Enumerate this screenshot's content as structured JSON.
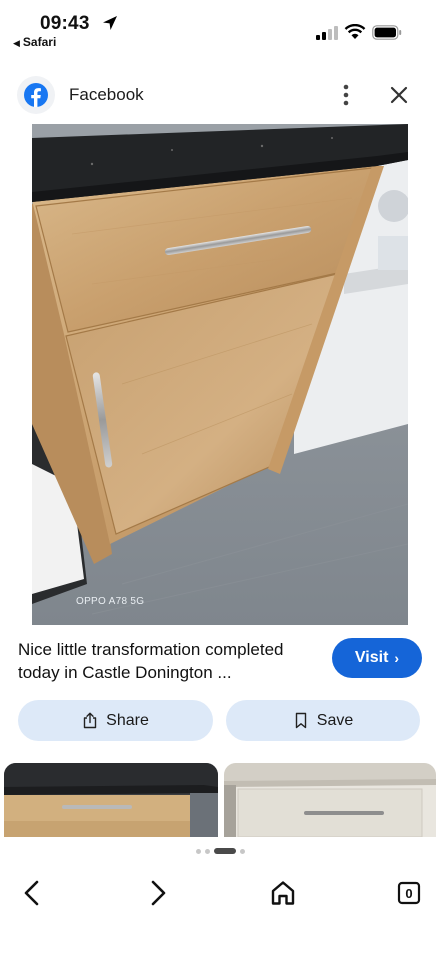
{
  "status_bar": {
    "time": "09:43",
    "back_app": "Safari",
    "icons": [
      "location-arrow-icon",
      "signal-icon",
      "wifi-icon",
      "battery-icon"
    ]
  },
  "header": {
    "title": "Facebook",
    "logo_icon": "facebook-logo-icon",
    "more_icon": "more-vertical-icon",
    "close_icon": "close-icon",
    "brand_color": "#1877f2"
  },
  "photo": {
    "subject": "oak-effect kitchen cabinet with black worktop and steel bar handles",
    "watermark": "OPPO A78 5G"
  },
  "post": {
    "caption": "Nice little transformation completed today in Castle Donington ...",
    "visit_label": "Visit",
    "visit_color": "#1565d8"
  },
  "actions": {
    "share_label": "Share",
    "save_label": "Save",
    "share_icon": "share-icon",
    "save_icon": "bookmark-icon",
    "button_color": "#dde9f8"
  },
  "thumbnails": [
    "cabinet-before-thumbnail",
    "cabinet-grey-thumbnail"
  ],
  "pager": {
    "count": 4,
    "active": 2
  },
  "toolbar": {
    "back_icon": "chevron-left-icon",
    "forward_icon": "chevron-right-icon",
    "home_icon": "home-icon",
    "tabs_count": "0"
  }
}
